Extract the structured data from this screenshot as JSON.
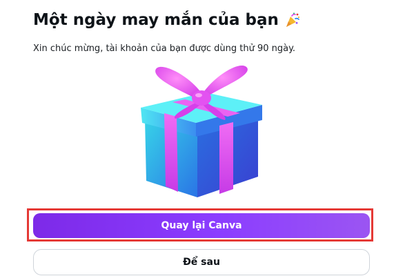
{
  "dialog": {
    "title": "Một ngày may mắn của bạn",
    "title_icon": "party-popper-icon",
    "subtitle": "Xin chúc mừng, tài khoản của bạn được dùng thử 90 ngày.",
    "illustration": "gift-box-icon"
  },
  "actions": {
    "primary_label": "Quay lại Canva",
    "secondary_label": "Để sau"
  },
  "colors": {
    "primary": "#8b3dff",
    "highlight": "#e53935",
    "gift_box": "#2f8df2",
    "gift_ribbon": "#e24cf0"
  }
}
